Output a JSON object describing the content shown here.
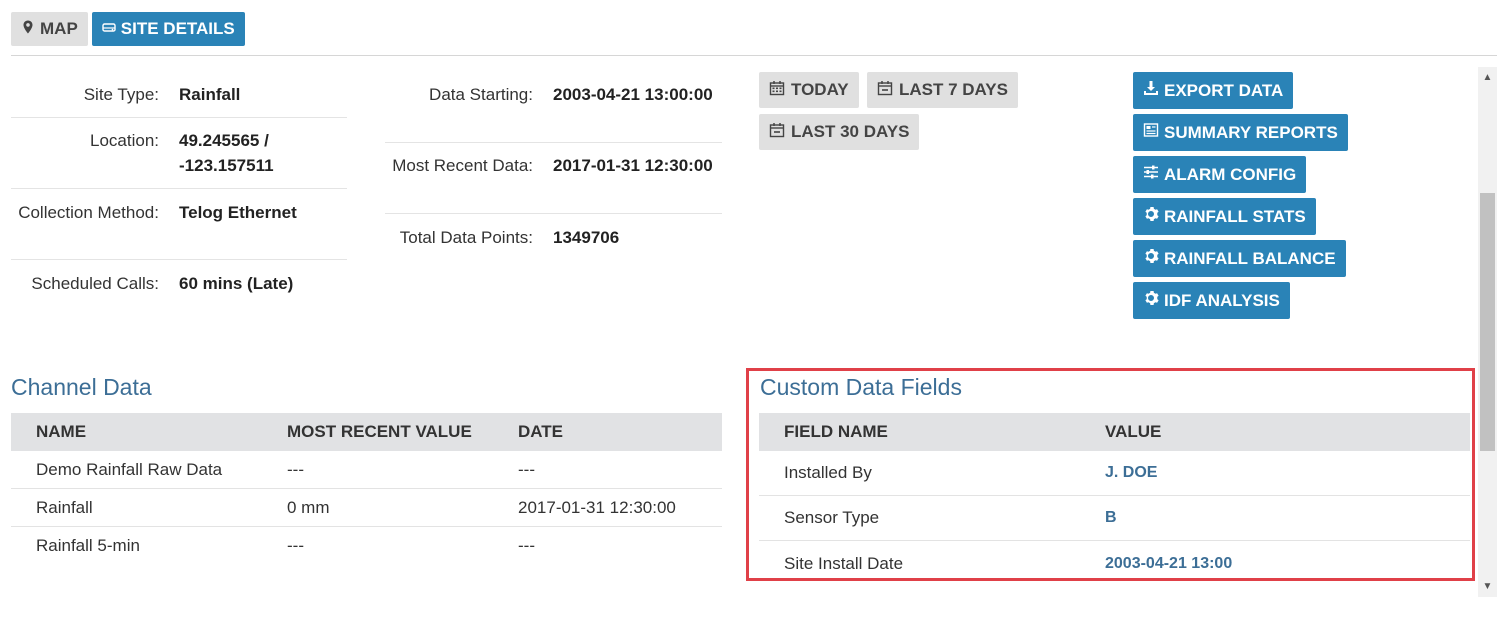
{
  "tabs": {
    "map_label": "MAP",
    "site_details_label": "SITE DETAILS"
  },
  "site_info": [
    {
      "label": "Site Type:",
      "value": "Rainfall"
    },
    {
      "label": "Location:",
      "value": "49.245565 / -123.157511"
    },
    {
      "label": "Collection Method:",
      "value": "Telog Ethernet"
    },
    {
      "label": "Scheduled Calls:",
      "value": "60 mins (Late)"
    }
  ],
  "data_info": [
    {
      "label": "Data Starting:",
      "value": "2003-04-21 13:00:00"
    },
    {
      "label": "Most Recent Data:",
      "value": "2017-01-31 12:30:00"
    },
    {
      "label": "Total Data Points:",
      "value": "1349706"
    }
  ],
  "date_buttons": {
    "today": "TODAY",
    "last7": "LAST 7 DAYS",
    "last30": "LAST 30 DAYS"
  },
  "actions": {
    "export": "EXPORT DATA",
    "summary": "SUMMARY REPORTS",
    "alarm": "ALARM CONFIG",
    "stats": "RAINFALL STATS",
    "balance": "RAINFALL BALANCE",
    "idf": "IDF ANALYSIS"
  },
  "channel_data": {
    "title": "Channel Data",
    "headers": [
      "NAME",
      "MOST RECENT VALUE",
      "DATE"
    ],
    "rows": [
      [
        "Demo Rainfall Raw Data",
        "---",
        "---"
      ],
      [
        "Rainfall",
        "0 mm",
        "2017-01-31 12:30:00"
      ],
      [
        "Rainfall 5-min",
        "---",
        "---"
      ]
    ]
  },
  "custom_fields": {
    "title": "Custom Data Fields",
    "headers": [
      "FIELD NAME",
      "VALUE"
    ],
    "rows": [
      [
        "Installed By",
        "J. DOE"
      ],
      [
        "Sensor Type",
        "B"
      ],
      [
        "Site Install Date",
        "2003-04-21 13:00"
      ]
    ]
  },
  "colors": {
    "primary": "#2a83b7",
    "title": "#3c6e96",
    "highlight": "#e04048"
  }
}
